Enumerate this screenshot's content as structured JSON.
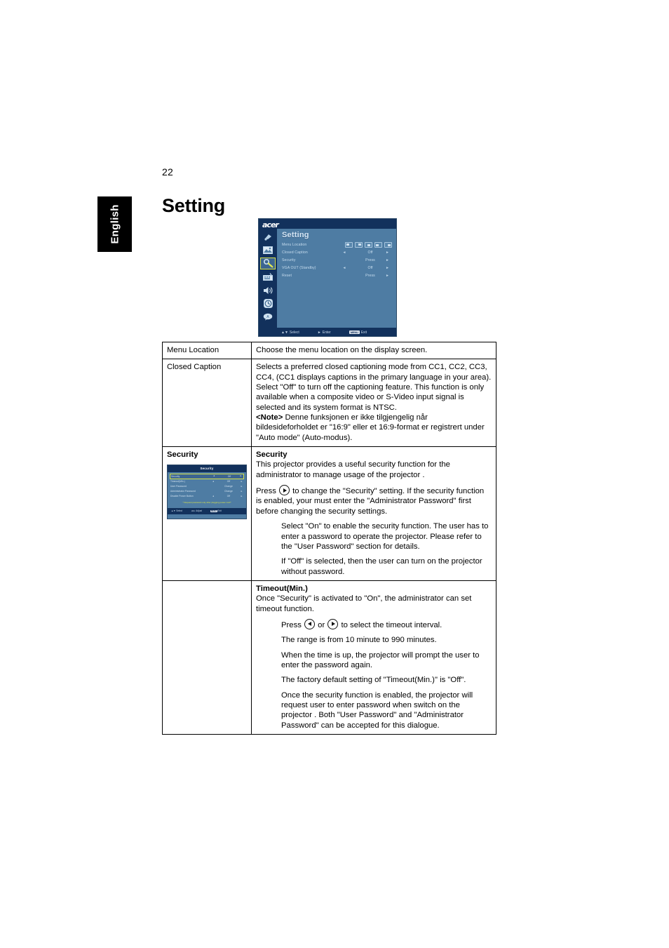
{
  "page": {
    "number": "22",
    "language_tab": "English",
    "chapter_title": "Setting"
  },
  "osd_setting": {
    "logo": "acer",
    "title": "Setting",
    "sidebar_icons": [
      "color-icon",
      "image-icon",
      "setting-wrench-icon",
      "management-icon",
      "audio-speaker-icon",
      "timer-clock-icon",
      "language-icon"
    ],
    "rows": [
      {
        "label": "Menu Location",
        "arrow_left": "",
        "value": "",
        "arrow_right": ""
      },
      {
        "label": "Closed Caption",
        "arrow_left": "◄",
        "value": "Off",
        "arrow_right": "►"
      },
      {
        "label": "Security",
        "arrow_left": "",
        "value": "Press",
        "arrow_right": "►"
      },
      {
        "label": "VGA OUT (Standby)",
        "arrow_left": "◄",
        "value": "Off",
        "arrow_right": "►"
      },
      {
        "label": "Reset",
        "arrow_left": "",
        "value": "Press",
        "arrow_right": "►"
      }
    ],
    "footer": {
      "select_arrows": "▲▼",
      "select_label": "Select",
      "enter_arrow": "►",
      "enter_label": "Enter",
      "menu_chip": "MENU",
      "exit_label": "Exit"
    }
  },
  "osd_security": {
    "title": "Security",
    "rows": [
      {
        "label": "Security",
        "arrow_left": "◄",
        "value": "Off",
        "arrow_right": "►",
        "highlighted": true
      },
      {
        "label": "Timeout(Min.)",
        "arrow_left": "◄",
        "value": "Off",
        "arrow_right": "►",
        "highlighted": false
      },
      {
        "label": "User Password",
        "arrow_left": "",
        "value": "Change",
        "arrow_right": "►",
        "highlighted": false
      },
      {
        "label": "Administrator Password",
        "arrow_left": "",
        "value": "Change",
        "arrow_right": "►",
        "highlighted": false
      },
      {
        "label": "Disable Power Button",
        "arrow_left": "◄",
        "value": "Off",
        "arrow_right": "►",
        "highlighted": false
      }
    ],
    "note": "* Request password only after plugging power cord*",
    "footer": {
      "select_arrows": "▲▼",
      "select_label": "Select",
      "adjust_arrows": "◄►",
      "adjust_label": "Adjust",
      "menu_chip": "MENU",
      "exit_label": "Exit"
    }
  },
  "table": {
    "rows": [
      {
        "name": "menu-location",
        "left_label": "Menu Location",
        "right_paragraphs": [
          "Choose the menu location on the display screen."
        ]
      },
      {
        "name": "closed-caption",
        "left_label": "Closed Caption",
        "right_paragraphs": [
          "Selects a preferred closed captioning mode from CC1, CC2, CC3, CC4, (CC1 displays captions in the primary language in your area). Select \"Off\" to turn off the captioning feature. This function is only available when a composite video or S-Video input signal is selected and its system format is NTSC."
        ],
        "note_label": "<Note>",
        "note_text": " Denne funksjonen er ikke tilgjengelig når bildesideforholdet er \"16:9\" eller et 16:9-format er registrert under \"Auto mode\" (Auto-modus)."
      },
      {
        "name": "security",
        "left_label": "Security",
        "heading": "Security",
        "intro": "This projector provides a useful security function for the administrator to manage usage of the projector .",
        "press_prefix": "Press",
        "press_suffix": "to change the \"Security\" setting. If the security function is enabled, your must enter the \"Administrator Password\" first before changing the security settings.",
        "bullets": [
          "Select \"On\" to enable the security function. The user has to enter a password to operate the projector. Please refer to the \"User Password\" section for details.",
          "If \"Off\" is selected, then the user can turn on the projector without password."
        ]
      },
      {
        "name": "timeout",
        "left_label": "",
        "heading": "Timeout(Min.)",
        "intro": "Once \"Security\" is activated to \"On\", the administrator can set timeout function.",
        "press_prefix": "Press",
        "press_middle": "or",
        "press_suffix": "to select the timeout interval.",
        "bullets": [
          "The range is from 10 minute to 990 minutes.",
          "When the time is up, the projector will prompt the user to enter the password again.",
          "The factory default setting of \"Timeout(Min.)\" is \"Off\".",
          "Once the security function is enabled, the projector will request user to enter password when switch on the projector . Both \"User Password\" and \"Administrator Password\" can be accepted for this dialogue."
        ]
      }
    ]
  },
  "colors": {
    "osd_body": "#4e7ca3",
    "osd_header": "#12315c",
    "osd_highlight_border": "#d8e24a",
    "tab_background": "#000000"
  }
}
